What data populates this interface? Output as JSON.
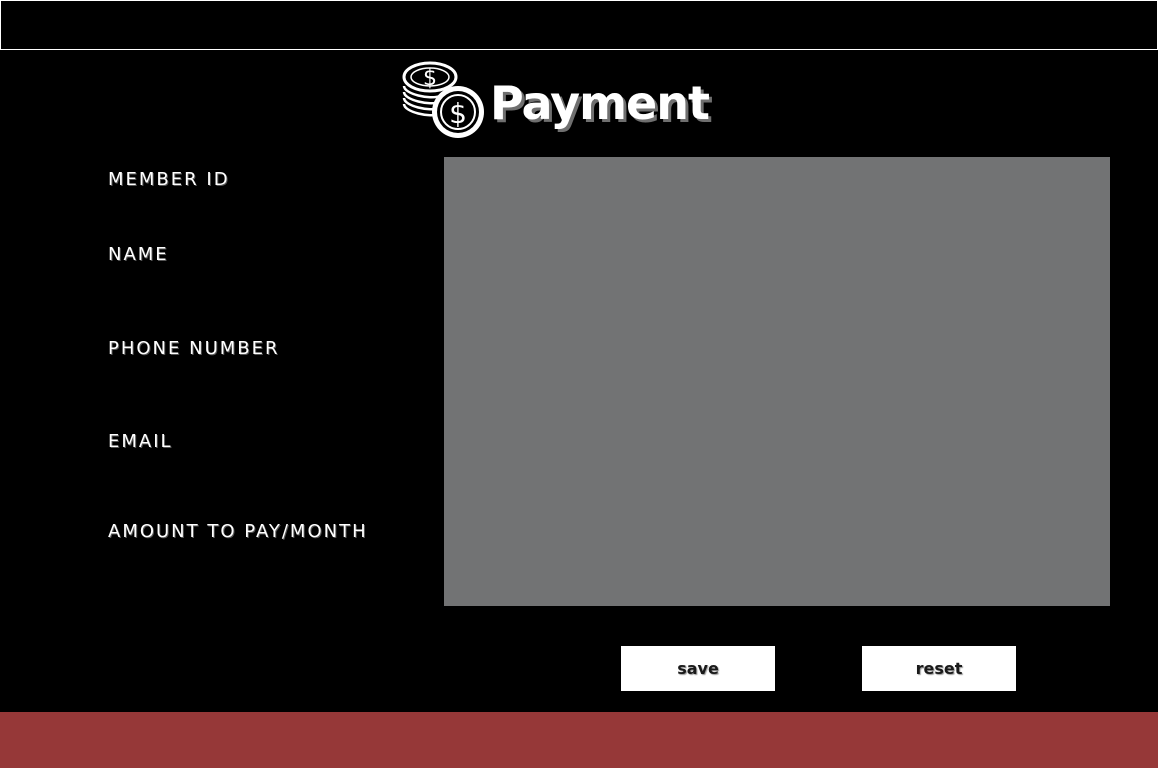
{
  "header": {
    "title": "Payment",
    "icon": "coins-dollar-icon"
  },
  "form": {
    "labels": {
      "member_id": "MEMBER ID",
      "name": "NAME",
      "phone_number": "PHONE NUMBER",
      "email": "EMAIL",
      "amount": "AMOUNT TO PAY/MONTH"
    }
  },
  "actions": {
    "save_label": "save",
    "reset_label": "reset"
  },
  "colors": {
    "background": "#000000",
    "panel": "#727374",
    "footer": "#963838",
    "button": "#ffffff"
  }
}
